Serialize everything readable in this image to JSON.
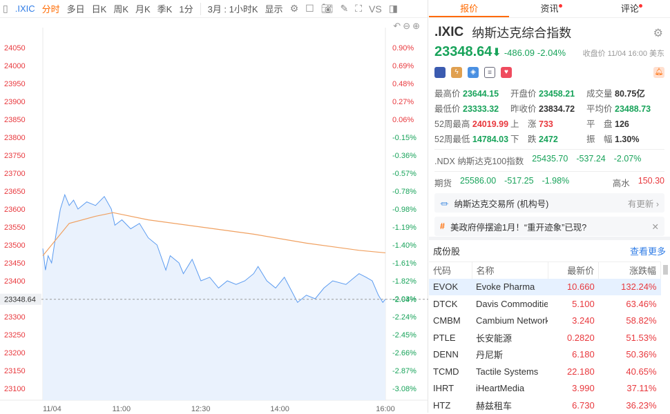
{
  "toolbar": {
    "symbol": ".IXIC",
    "items": [
      "分时",
      "多日",
      "日K",
      "周K",
      "月K",
      "季K",
      "1分",
      "3月 : 1小时K",
      "显示"
    ],
    "vs": "VS"
  },
  "chart_data": {
    "type": "line",
    "title": ".IXIC 分时",
    "yticks": [
      24050,
      24000,
      23950,
      23900,
      23850,
      23800,
      23750,
      23700,
      23650,
      23600,
      23550,
      23500,
      23450,
      23400,
      23350,
      23300,
      23250,
      23200,
      23150,
      23100
    ],
    "pct_ticks": [
      "0.90%",
      "0.69%",
      "0.48%",
      "0.27%",
      "0.06%",
      "-0.15%",
      "-0.36%",
      "-0.57%",
      "-0.78%",
      "-0.98%",
      "-1.19%",
      "-1.40%",
      "-1.61%",
      "-1.82%",
      "-2.03%",
      "-2.24%",
      "-2.45%",
      "-2.66%",
      "-2.87%",
      "-3.08%"
    ],
    "xticks": [
      "11/04",
      "11:00",
      "12:30",
      "14:00",
      "16:00"
    ],
    "current_label": "23348.64",
    "current_pct": "-2.04%",
    "ylim": [
      23080,
      24070
    ],
    "series": [
      {
        "name": "price",
        "points": [
          [
            0,
            23490
          ],
          [
            3,
            23430
          ],
          [
            6,
            23470
          ],
          [
            10,
            23450
          ],
          [
            15,
            23530
          ],
          [
            20,
            23600
          ],
          [
            25,
            23640
          ],
          [
            30,
            23610
          ],
          [
            35,
            23625
          ],
          [
            40,
            23600
          ],
          [
            50,
            23620
          ],
          [
            60,
            23610
          ],
          [
            70,
            23635
          ],
          [
            78,
            23600
          ],
          [
            82,
            23555
          ],
          [
            90,
            23570
          ],
          [
            100,
            23545
          ],
          [
            110,
            23560
          ],
          [
            120,
            23520
          ],
          [
            130,
            23500
          ],
          [
            140,
            23430
          ],
          [
            145,
            23470
          ],
          [
            155,
            23450
          ],
          [
            160,
            23420
          ],
          [
            170,
            23460
          ],
          [
            180,
            23400
          ],
          [
            190,
            23410
          ],
          [
            200,
            23380
          ],
          [
            210,
            23400
          ],
          [
            220,
            23390
          ],
          [
            230,
            23400
          ],
          [
            240,
            23420
          ],
          [
            245,
            23440
          ],
          [
            255,
            23400
          ],
          [
            265,
            23380
          ],
          [
            275,
            23410
          ],
          [
            290,
            23340
          ],
          [
            300,
            23360
          ],
          [
            310,
            23350
          ],
          [
            320,
            23380
          ],
          [
            330,
            23400
          ],
          [
            345,
            23390
          ],
          [
            360,
            23420
          ],
          [
            368,
            23410
          ],
          [
            375,
            23400
          ],
          [
            382,
            23360
          ],
          [
            387,
            23340
          ],
          [
            390,
            23349
          ]
        ]
      },
      {
        "name": "average",
        "points": [
          [
            0,
            23470
          ],
          [
            10,
            23500
          ],
          [
            30,
            23560
          ],
          [
            60,
            23580
          ],
          [
            80,
            23590
          ],
          [
            120,
            23570
          ],
          [
            180,
            23550
          ],
          [
            240,
            23530
          ],
          [
            300,
            23505
          ],
          [
            360,
            23485
          ],
          [
            390,
            23478
          ]
        ]
      }
    ]
  },
  "tabs": [
    "报价",
    "资讯",
    "评论"
  ],
  "quote": {
    "symbol": ".IXIC",
    "name": "纳斯达克综合指数",
    "price": "23348.64",
    "arrow": "⬇",
    "change": "-486.09",
    "pct": "-2.04%",
    "close_label": "收盘价 11/04 16:00 美东",
    "stats": [
      [
        "最高价",
        "23644.15",
        "g"
      ],
      [
        "开盘价",
        "23458.21",
        "g"
      ],
      [
        "成交量",
        "80.75亿",
        "k"
      ],
      [
        "最低价",
        "23333.32",
        "g"
      ],
      [
        "昨收价",
        "23834.72",
        "k"
      ],
      [
        "平均价",
        "23488.73",
        "g"
      ],
      [
        "52周最高",
        "24019.99",
        "r"
      ],
      [
        "上　涨",
        "733",
        "r"
      ],
      [
        "平　盘",
        "126",
        "k"
      ],
      [
        "52周最低",
        "14784.03",
        "g"
      ],
      [
        "下　跌",
        "2472",
        "g"
      ],
      [
        "振　幅",
        "1.30%",
        "k"
      ]
    ]
  },
  "ndx": {
    "label": ".NDX 纳斯达克100指数",
    "price": "25435.70",
    "change": "-537.24",
    "pct": "-2.07%"
  },
  "futures": {
    "label": "期货",
    "price": "25586.00",
    "change": "-517.25",
    "pct": "-1.98%",
    "prem_label": "高水",
    "prem": "150.30"
  },
  "cards": [
    {
      "text": "纳斯达克交易所 (机构号)",
      "more": "有更新 ›"
    },
    {
      "text": "美政府停摆逾1月！“重开迹象”已现?",
      "more": "✕"
    }
  ],
  "components": {
    "title": "成份股",
    "more": "查看更多",
    "headers": [
      "代码",
      "名称",
      "最新价",
      "涨跌幅"
    ],
    "rows": [
      [
        "EVOK",
        "Evoke Pharma",
        "10.660",
        "132.24%"
      ],
      [
        "DTCK",
        "Davis Commodities",
        "5.100",
        "63.46%"
      ],
      [
        "CMBM",
        "Cambium Networks",
        "3.240",
        "58.82%"
      ],
      [
        "PTLE",
        "长安能源",
        "0.2820",
        "51.53%"
      ],
      [
        "DENN",
        "丹尼斯",
        "6.180",
        "50.36%"
      ],
      [
        "TCMD",
        "Tactile Systems",
        "22.180",
        "40.65%"
      ],
      [
        "IHRT",
        "iHeartMedia",
        "3.990",
        "37.11%"
      ],
      [
        "HTZ",
        "赫兹租车",
        "6.730",
        "36.23%"
      ]
    ]
  }
}
